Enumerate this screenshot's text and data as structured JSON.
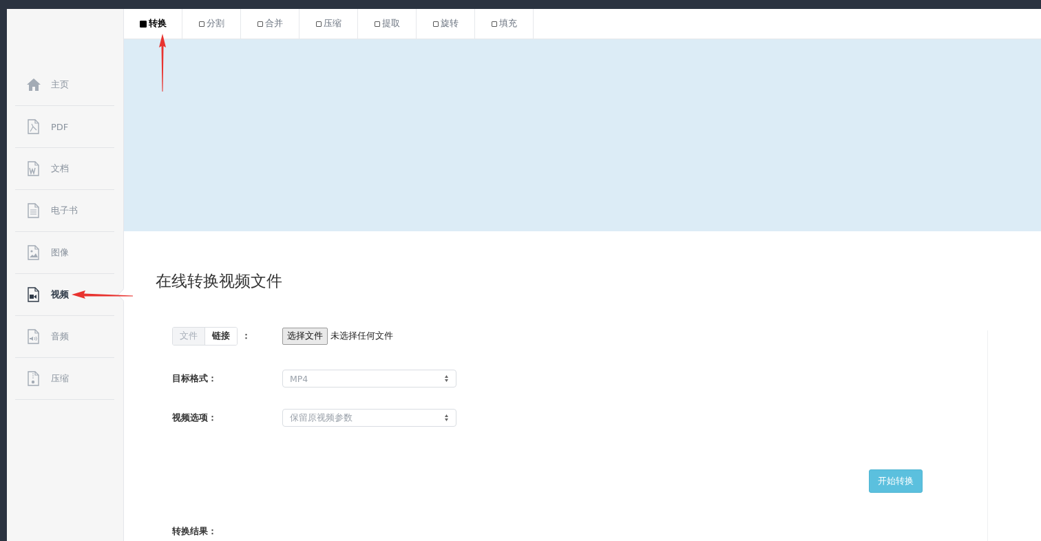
{
  "tabs": [
    {
      "label": "转换",
      "selected": true
    },
    {
      "label": "分割",
      "selected": false
    },
    {
      "label": "合并",
      "selected": false
    },
    {
      "label": "压缩",
      "selected": false
    },
    {
      "label": "提取",
      "selected": false
    },
    {
      "label": "旋转",
      "selected": false
    },
    {
      "label": "填充",
      "selected": false
    }
  ],
  "sidebar": {
    "items": [
      {
        "label": "主页",
        "selected": false
      },
      {
        "label": "PDF",
        "selected": false
      },
      {
        "label": "文档",
        "selected": false
      },
      {
        "label": "电子书",
        "selected": false
      },
      {
        "label": "图像",
        "selected": false
      },
      {
        "label": "视频",
        "selected": true
      },
      {
        "label": "音频",
        "selected": false
      },
      {
        "label": "压缩",
        "selected": false
      }
    ]
  },
  "heading": "在线转换视频文件",
  "form": {
    "source_toggle": [
      {
        "label": "文件",
        "selected": true
      },
      {
        "label": "链接",
        "selected": false
      }
    ],
    "source_colon": "：",
    "file_button": "选择文件",
    "file_status": "未选择任何文件",
    "fields": [
      {
        "label": "目标格式：",
        "value": "MP4"
      },
      {
        "label": "视频选项：",
        "value": "保留原视频参数"
      }
    ],
    "submit": "开始转换",
    "result_label": "转换结果："
  }
}
